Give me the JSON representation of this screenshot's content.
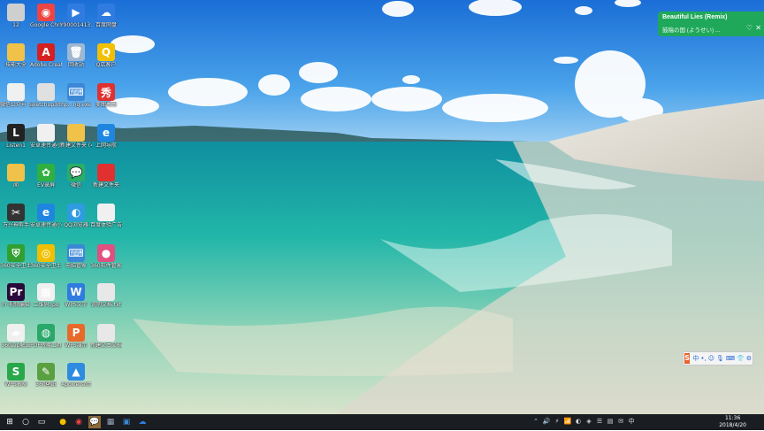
{
  "music_widget": {
    "title": "Beautiful Lies (Remix)",
    "subtitle": "鼓稿の国 (ようせい) ...",
    "close": "✕",
    "like": "♡"
  },
  "desktop_icons": [
    {
      "label": "12",
      "color": "#cfcfcf",
      "glyph": ""
    },
    {
      "label": "Google Chrome",
      "color": "#e44",
      "glyph": "◉"
    },
    {
      "label": "Y90001413…",
      "color": "#2f7be0",
      "glyph": "▶"
    },
    {
      "label": "百度网盘",
      "color": "#2f7be0",
      "glyph": "☁"
    },
    {
      "label": "技能大全",
      "color": "#f0c24a",
      "glyph": ""
    },
    {
      "label": "Adobe Creat…",
      "color": "#d42020",
      "glyph": "A"
    },
    {
      "label": "回收站",
      "color": "#9fb7d0",
      "glyph": "🗑"
    },
    {
      "label": "Q店客户",
      "color": "#f2c000",
      "glyph": "Q"
    },
    {
      "label": "微信公众号 .exe",
      "color": "#f0f0f0",
      "glyph": ""
    },
    {
      "label": "sketchup3d…",
      "color": "#e0e0e0",
      "glyph": ""
    },
    {
      "label": "hp…ng.exe",
      "color": "#3b87d6",
      "glyph": "⌨"
    },
    {
      "label": "美图秀秀",
      "color": "#e03030",
      "glyph": "秀"
    },
    {
      "label": "Listen1",
      "color": "#222",
      "glyph": "L"
    },
    {
      "label": "安卓速传通小程序安装",
      "color": "#f0f0f0",
      "glyph": ""
    },
    {
      "label": "新建文件夹 (4)",
      "color": "#f0c24a",
      "glyph": ""
    },
    {
      "label": "上网导航",
      "color": "#1f86e0",
      "glyph": "e"
    },
    {
      "label": "闻",
      "color": "#f0c24a",
      "glyph": ""
    },
    {
      "label": "EV录屏",
      "color": "#30b040",
      "glyph": "✿"
    },
    {
      "label": "微信",
      "color": "#2aae67",
      "glyph": "💬"
    },
    {
      "label": "新建文件夹",
      "color": "#e03030",
      "glyph": ""
    },
    {
      "label": "万兴神剪手",
      "color": "#333",
      "glyph": "✂"
    },
    {
      "label": "安卓速传通小程序安装",
      "color": "#1f86e0",
      "glyph": "e"
    },
    {
      "label": "QQ浏览器",
      "color": "#2f9be0",
      "glyph": "◐"
    },
    {
      "label": "百度体验广告图",
      "color": "#f0f0f0",
      "glyph": ""
    },
    {
      "label": "360安全卫士",
      "color": "#30a030",
      "glyph": "⛨"
    },
    {
      "label": "360安全卫士",
      "color": "#f0c000",
      "glyph": "◎"
    },
    {
      "label": "电脑管家",
      "color": "#3b87d6",
      "glyph": "⌨"
    },
    {
      "label": "360软件管家",
      "color": "#e05080",
      "glyph": "●"
    },
    {
      "label": "Pr 视频编辑",
      "color": "#2a0a3a",
      "glyph": "Pr"
    },
    {
      "label": "二维码.jpg",
      "color": "#f0f0f0",
      "glyph": "▦"
    },
    {
      "label": "WPS文字",
      "color": "#2f7be0",
      "glyph": "W"
    },
    {
      "label": "说明文档.txt",
      "color": "#e8e8e8",
      "glyph": ""
    },
    {
      "label": "360Zip解压",
      "color": "#f0f0f0",
      "glyph": "▰"
    },
    {
      "label": "PDF转换工具",
      "color": "#2aa86a",
      "glyph": "◍"
    },
    {
      "label": "WPS演示",
      "color": "#e86a2a",
      "glyph": "P"
    },
    {
      "label": "新建文本文档",
      "color": "#e8e8e8",
      "glyph": ""
    },
    {
      "label": "WPS表格",
      "color": "#28a84a",
      "glyph": "S"
    },
    {
      "label": "360壁纸",
      "color": "#5aa040",
      "glyph": "✎"
    },
    {
      "label": "Apowersoft",
      "color": "#2f8be0",
      "glyph": "▲"
    }
  ],
  "ime_bar": {
    "logo": "S",
    "items": [
      "中",
      "•,",
      "☺",
      "🎙",
      "⌨",
      "👕",
      "⚙"
    ]
  },
  "taskbar": {
    "start": "⊞",
    "search": "○",
    "taskview": "▭",
    "apps": [
      {
        "glyph": "●",
        "color": "#f0c000"
      },
      {
        "glyph": "◉",
        "color": "#e44"
      },
      {
        "glyph": "💬",
        "color": "#2aae67"
      },
      {
        "glyph": "▦",
        "color": "#9ab"
      },
      {
        "glyph": "▣",
        "color": "#3b87d6"
      },
      {
        "glyph": "☁",
        "color": "#2f7be0"
      }
    ],
    "tray": [
      "⌃",
      "🔊",
      "⚡",
      "📶",
      "◐",
      "◈",
      "☰",
      "▤",
      "✉",
      "中"
    ],
    "time": "11:36",
    "date": "2018/4/20"
  }
}
